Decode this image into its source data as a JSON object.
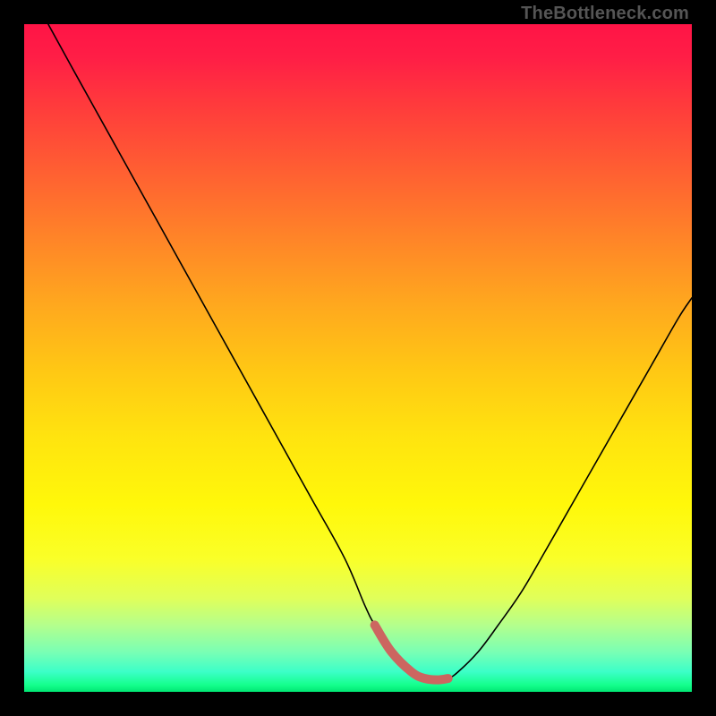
{
  "watermark": "TheBottleneck.com",
  "chart_data": {
    "type": "line",
    "title": "",
    "xlabel": "",
    "ylabel": "",
    "xlim": [
      0,
      100
    ],
    "ylim": [
      0,
      100
    ],
    "grid": false,
    "legend": false,
    "series": [
      {
        "name": "bottleneck-curve",
        "color": "#000000",
        "x": [
          3.6,
          8,
          13,
          18,
          23,
          28,
          33,
          38,
          43,
          48,
          51,
          52.5,
          55,
          58,
          60,
          62,
          63.5,
          65,
          68,
          71,
          74.5,
          78,
          82,
          86,
          90,
          94,
          98,
          100
        ],
        "y": [
          100,
          92,
          83,
          74,
          65,
          56,
          47,
          38,
          29,
          20,
          13,
          10,
          6,
          3,
          2,
          1.8,
          2,
          3,
          6,
          10,
          15,
          21,
          28,
          35,
          42,
          49,
          56,
          59
        ]
      },
      {
        "name": "highlight-trough",
        "color": "#cc6660",
        "x": [
          52.5,
          55,
          58,
          60,
          62,
          63.5
        ],
        "y": [
          10,
          6,
          3,
          2,
          1.8,
          2
        ]
      }
    ],
    "background_gradient": {
      "stops": [
        {
          "pos": 0.0,
          "color": "#ff1446"
        },
        {
          "pos": 0.22,
          "color": "#ff5f32"
        },
        {
          "pos": 0.52,
          "color": "#ffc814"
        },
        {
          "pos": 0.8,
          "color": "#faff28"
        },
        {
          "pos": 0.94,
          "color": "#7affb4"
        },
        {
          "pos": 1.0,
          "color": "#00e673"
        }
      ]
    }
  }
}
